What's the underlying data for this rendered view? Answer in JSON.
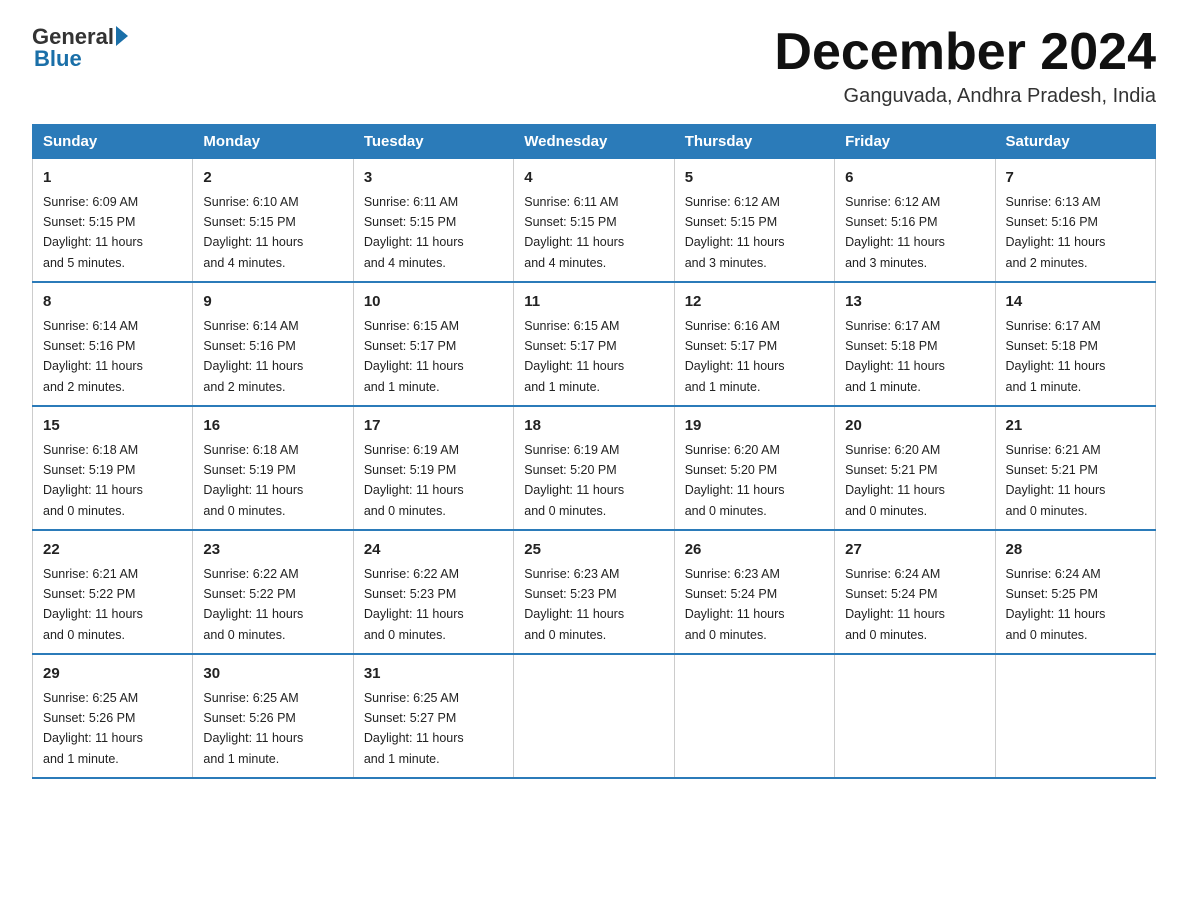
{
  "logo": {
    "general": "General",
    "blue": "Blue"
  },
  "title": "December 2024",
  "location": "Ganguvada, Andhra Pradesh, India",
  "days_of_week": [
    "Sunday",
    "Monday",
    "Tuesday",
    "Wednesday",
    "Thursday",
    "Friday",
    "Saturday"
  ],
  "weeks": [
    [
      {
        "day": "1",
        "sunrise": "6:09 AM",
        "sunset": "5:15 PM",
        "daylight": "11 hours and 5 minutes."
      },
      {
        "day": "2",
        "sunrise": "6:10 AM",
        "sunset": "5:15 PM",
        "daylight": "11 hours and 4 minutes."
      },
      {
        "day": "3",
        "sunrise": "6:11 AM",
        "sunset": "5:15 PM",
        "daylight": "11 hours and 4 minutes."
      },
      {
        "day": "4",
        "sunrise": "6:11 AM",
        "sunset": "5:15 PM",
        "daylight": "11 hours and 4 minutes."
      },
      {
        "day": "5",
        "sunrise": "6:12 AM",
        "sunset": "5:15 PM",
        "daylight": "11 hours and 3 minutes."
      },
      {
        "day": "6",
        "sunrise": "6:12 AM",
        "sunset": "5:16 PM",
        "daylight": "11 hours and 3 minutes."
      },
      {
        "day": "7",
        "sunrise": "6:13 AM",
        "sunset": "5:16 PM",
        "daylight": "11 hours and 2 minutes."
      }
    ],
    [
      {
        "day": "8",
        "sunrise": "6:14 AM",
        "sunset": "5:16 PM",
        "daylight": "11 hours and 2 minutes."
      },
      {
        "day": "9",
        "sunrise": "6:14 AM",
        "sunset": "5:16 PM",
        "daylight": "11 hours and 2 minutes."
      },
      {
        "day": "10",
        "sunrise": "6:15 AM",
        "sunset": "5:17 PM",
        "daylight": "11 hours and 1 minute."
      },
      {
        "day": "11",
        "sunrise": "6:15 AM",
        "sunset": "5:17 PM",
        "daylight": "11 hours and 1 minute."
      },
      {
        "day": "12",
        "sunrise": "6:16 AM",
        "sunset": "5:17 PM",
        "daylight": "11 hours and 1 minute."
      },
      {
        "day": "13",
        "sunrise": "6:17 AM",
        "sunset": "5:18 PM",
        "daylight": "11 hours and 1 minute."
      },
      {
        "day": "14",
        "sunrise": "6:17 AM",
        "sunset": "5:18 PM",
        "daylight": "11 hours and 1 minute."
      }
    ],
    [
      {
        "day": "15",
        "sunrise": "6:18 AM",
        "sunset": "5:19 PM",
        "daylight": "11 hours and 0 minutes."
      },
      {
        "day": "16",
        "sunrise": "6:18 AM",
        "sunset": "5:19 PM",
        "daylight": "11 hours and 0 minutes."
      },
      {
        "day": "17",
        "sunrise": "6:19 AM",
        "sunset": "5:19 PM",
        "daylight": "11 hours and 0 minutes."
      },
      {
        "day": "18",
        "sunrise": "6:19 AM",
        "sunset": "5:20 PM",
        "daylight": "11 hours and 0 minutes."
      },
      {
        "day": "19",
        "sunrise": "6:20 AM",
        "sunset": "5:20 PM",
        "daylight": "11 hours and 0 minutes."
      },
      {
        "day": "20",
        "sunrise": "6:20 AM",
        "sunset": "5:21 PM",
        "daylight": "11 hours and 0 minutes."
      },
      {
        "day": "21",
        "sunrise": "6:21 AM",
        "sunset": "5:21 PM",
        "daylight": "11 hours and 0 minutes."
      }
    ],
    [
      {
        "day": "22",
        "sunrise": "6:21 AM",
        "sunset": "5:22 PM",
        "daylight": "11 hours and 0 minutes."
      },
      {
        "day": "23",
        "sunrise": "6:22 AM",
        "sunset": "5:22 PM",
        "daylight": "11 hours and 0 minutes."
      },
      {
        "day": "24",
        "sunrise": "6:22 AM",
        "sunset": "5:23 PM",
        "daylight": "11 hours and 0 minutes."
      },
      {
        "day": "25",
        "sunrise": "6:23 AM",
        "sunset": "5:23 PM",
        "daylight": "11 hours and 0 minutes."
      },
      {
        "day": "26",
        "sunrise": "6:23 AM",
        "sunset": "5:24 PM",
        "daylight": "11 hours and 0 minutes."
      },
      {
        "day": "27",
        "sunrise": "6:24 AM",
        "sunset": "5:24 PM",
        "daylight": "11 hours and 0 minutes."
      },
      {
        "day": "28",
        "sunrise": "6:24 AM",
        "sunset": "5:25 PM",
        "daylight": "11 hours and 0 minutes."
      }
    ],
    [
      {
        "day": "29",
        "sunrise": "6:25 AM",
        "sunset": "5:26 PM",
        "daylight": "11 hours and 1 minute."
      },
      {
        "day": "30",
        "sunrise": "6:25 AM",
        "sunset": "5:26 PM",
        "daylight": "11 hours and 1 minute."
      },
      {
        "day": "31",
        "sunrise": "6:25 AM",
        "sunset": "5:27 PM",
        "daylight": "11 hours and 1 minute."
      },
      null,
      null,
      null,
      null
    ]
  ],
  "labels": {
    "sunrise": "Sunrise:",
    "sunset": "Sunset:",
    "daylight": "Daylight:"
  }
}
